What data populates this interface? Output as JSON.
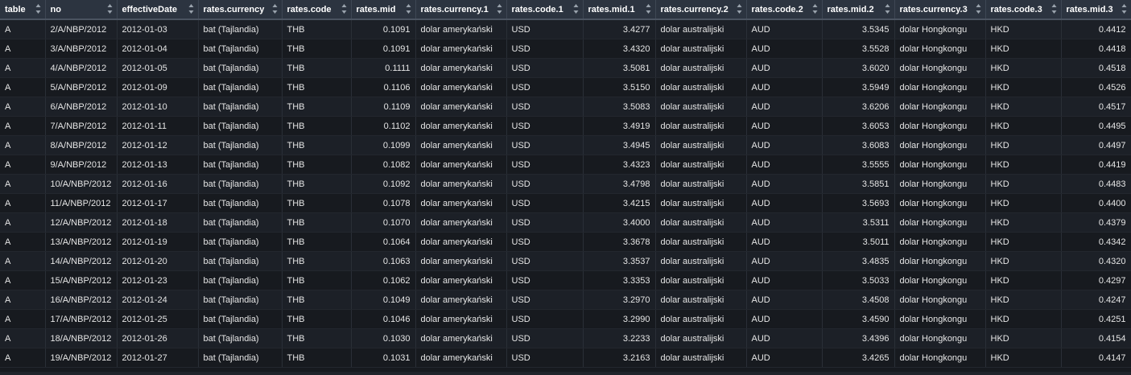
{
  "columns": [
    {
      "key": "table",
      "label": "table"
    },
    {
      "key": "no",
      "label": "no"
    },
    {
      "key": "effectiveDate",
      "label": "effectiveDate"
    },
    {
      "key": "rates_currency",
      "label": "rates.currency"
    },
    {
      "key": "rates_code",
      "label": "rates.code"
    },
    {
      "key": "rates_mid",
      "label": "rates.mid"
    },
    {
      "key": "rates_currency_1",
      "label": "rates.currency.1"
    },
    {
      "key": "rates_code_1",
      "label": "rates.code.1"
    },
    {
      "key": "rates_mid_1",
      "label": "rates.mid.1"
    },
    {
      "key": "rates_currency_2",
      "label": "rates.currency.2"
    },
    {
      "key": "rates_code_2",
      "label": "rates.code.2"
    },
    {
      "key": "rates_mid_2",
      "label": "rates.mid.2"
    },
    {
      "key": "rates_currency_3",
      "label": "rates.currency.3"
    },
    {
      "key": "rates_code_3",
      "label": "rates.code.3"
    },
    {
      "key": "rates_mid_3",
      "label": "rates.mid.3"
    }
  ],
  "rows": [
    [
      "A",
      "2/A/NBP/2012",
      "2012-01-03",
      "bat (Tajlandia)",
      "THB",
      "0.1091",
      "dolar amerykański",
      "USD",
      "3.4277",
      "dolar australijski",
      "AUD",
      "3.5345",
      "dolar Hongkongu",
      "HKD",
      "0.4412"
    ],
    [
      "A",
      "3/A/NBP/2012",
      "2012-01-04",
      "bat (Tajlandia)",
      "THB",
      "0.1091",
      "dolar amerykański",
      "USD",
      "3.4320",
      "dolar australijski",
      "AUD",
      "3.5528",
      "dolar Hongkongu",
      "HKD",
      "0.4418"
    ],
    [
      "A",
      "4/A/NBP/2012",
      "2012-01-05",
      "bat (Tajlandia)",
      "THB",
      "0.1111",
      "dolar amerykański",
      "USD",
      "3.5081",
      "dolar australijski",
      "AUD",
      "3.6020",
      "dolar Hongkongu",
      "HKD",
      "0.4518"
    ],
    [
      "A",
      "5/A/NBP/2012",
      "2012-01-09",
      "bat (Tajlandia)",
      "THB",
      "0.1106",
      "dolar amerykański",
      "USD",
      "3.5150",
      "dolar australijski",
      "AUD",
      "3.5949",
      "dolar Hongkongu",
      "HKD",
      "0.4526"
    ],
    [
      "A",
      "6/A/NBP/2012",
      "2012-01-10",
      "bat (Tajlandia)",
      "THB",
      "0.1109",
      "dolar amerykański",
      "USD",
      "3.5083",
      "dolar australijski",
      "AUD",
      "3.6206",
      "dolar Hongkongu",
      "HKD",
      "0.4517"
    ],
    [
      "A",
      "7/A/NBP/2012",
      "2012-01-11",
      "bat (Tajlandia)",
      "THB",
      "0.1102",
      "dolar amerykański",
      "USD",
      "3.4919",
      "dolar australijski",
      "AUD",
      "3.6053",
      "dolar Hongkongu",
      "HKD",
      "0.4495"
    ],
    [
      "A",
      "8/A/NBP/2012",
      "2012-01-12",
      "bat (Tajlandia)",
      "THB",
      "0.1099",
      "dolar amerykański",
      "USD",
      "3.4945",
      "dolar australijski",
      "AUD",
      "3.6083",
      "dolar Hongkongu",
      "HKD",
      "0.4497"
    ],
    [
      "A",
      "9/A/NBP/2012",
      "2012-01-13",
      "bat (Tajlandia)",
      "THB",
      "0.1082",
      "dolar amerykański",
      "USD",
      "3.4323",
      "dolar australijski",
      "AUD",
      "3.5555",
      "dolar Hongkongu",
      "HKD",
      "0.4419"
    ],
    [
      "A",
      "10/A/NBP/2012",
      "2012-01-16",
      "bat (Tajlandia)",
      "THB",
      "0.1092",
      "dolar amerykański",
      "USD",
      "3.4798",
      "dolar australijski",
      "AUD",
      "3.5851",
      "dolar Hongkongu",
      "HKD",
      "0.4483"
    ],
    [
      "A",
      "11/A/NBP/2012",
      "2012-01-17",
      "bat (Tajlandia)",
      "THB",
      "0.1078",
      "dolar amerykański",
      "USD",
      "3.4215",
      "dolar australijski",
      "AUD",
      "3.5693",
      "dolar Hongkongu",
      "HKD",
      "0.4400"
    ],
    [
      "A",
      "12/A/NBP/2012",
      "2012-01-18",
      "bat (Tajlandia)",
      "THB",
      "0.1070",
      "dolar amerykański",
      "USD",
      "3.4000",
      "dolar australijski",
      "AUD",
      "3.5311",
      "dolar Hongkongu",
      "HKD",
      "0.4379"
    ],
    [
      "A",
      "13/A/NBP/2012",
      "2012-01-19",
      "bat (Tajlandia)",
      "THB",
      "0.1064",
      "dolar amerykański",
      "USD",
      "3.3678",
      "dolar australijski",
      "AUD",
      "3.5011",
      "dolar Hongkongu",
      "HKD",
      "0.4342"
    ],
    [
      "A",
      "14/A/NBP/2012",
      "2012-01-20",
      "bat (Tajlandia)",
      "THB",
      "0.1063",
      "dolar amerykański",
      "USD",
      "3.3537",
      "dolar australijski",
      "AUD",
      "3.4835",
      "dolar Hongkongu",
      "HKD",
      "0.4320"
    ],
    [
      "A",
      "15/A/NBP/2012",
      "2012-01-23",
      "bat (Tajlandia)",
      "THB",
      "0.1062",
      "dolar amerykański",
      "USD",
      "3.3353",
      "dolar australijski",
      "AUD",
      "3.5033",
      "dolar Hongkongu",
      "HKD",
      "0.4297"
    ],
    [
      "A",
      "16/A/NBP/2012",
      "2012-01-24",
      "bat (Tajlandia)",
      "THB",
      "0.1049",
      "dolar amerykański",
      "USD",
      "3.2970",
      "dolar australijski",
      "AUD",
      "3.4508",
      "dolar Hongkongu",
      "HKD",
      "0.4247"
    ],
    [
      "A",
      "17/A/NBP/2012",
      "2012-01-25",
      "bat (Tajlandia)",
      "THB",
      "0.1046",
      "dolar amerykański",
      "USD",
      "3.2990",
      "dolar australijski",
      "AUD",
      "3.4590",
      "dolar Hongkongu",
      "HKD",
      "0.4251"
    ],
    [
      "A",
      "18/A/NBP/2012",
      "2012-01-26",
      "bat (Tajlandia)",
      "THB",
      "0.1030",
      "dolar amerykański",
      "USD",
      "3.2233",
      "dolar australijski",
      "AUD",
      "3.4396",
      "dolar Hongkongu",
      "HKD",
      "0.4154"
    ],
    [
      "A",
      "19/A/NBP/2012",
      "2012-01-27",
      "bat (Tajlandia)",
      "THB",
      "0.1031",
      "dolar amerykański",
      "USD",
      "3.2163",
      "dolar australijski",
      "AUD",
      "3.4265",
      "dolar Hongkongu",
      "HKD",
      "0.4147"
    ]
  ],
  "numeric_columns": [
    5,
    8,
    11,
    14
  ],
  "icons": {
    "sort": "sort-arrows-icon"
  },
  "colors": {
    "background": "#171a1f",
    "header": "#2c3440",
    "row_alt": "#1c2027",
    "text": "#e6e6e6"
  }
}
